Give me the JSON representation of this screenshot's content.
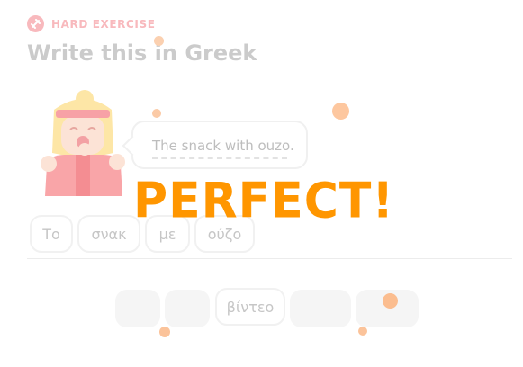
{
  "header": {
    "badge_label": "HARD EXERCISE",
    "badge_icon": "dumbbell-icon",
    "title": "Write this in Greek"
  },
  "prompt": {
    "sentence": "The snack with ouzo."
  },
  "answer_tiles": [
    "Το",
    "σνακ",
    "με",
    "ούζο"
  ],
  "word_bank": [
    "",
    "",
    "βίντεο",
    "",
    ""
  ],
  "feedback": {
    "text": "PERFECT!"
  },
  "colors": {
    "accent": "#ff9600",
    "badge": "#f8b9bd",
    "title": "#cbcbcb"
  }
}
